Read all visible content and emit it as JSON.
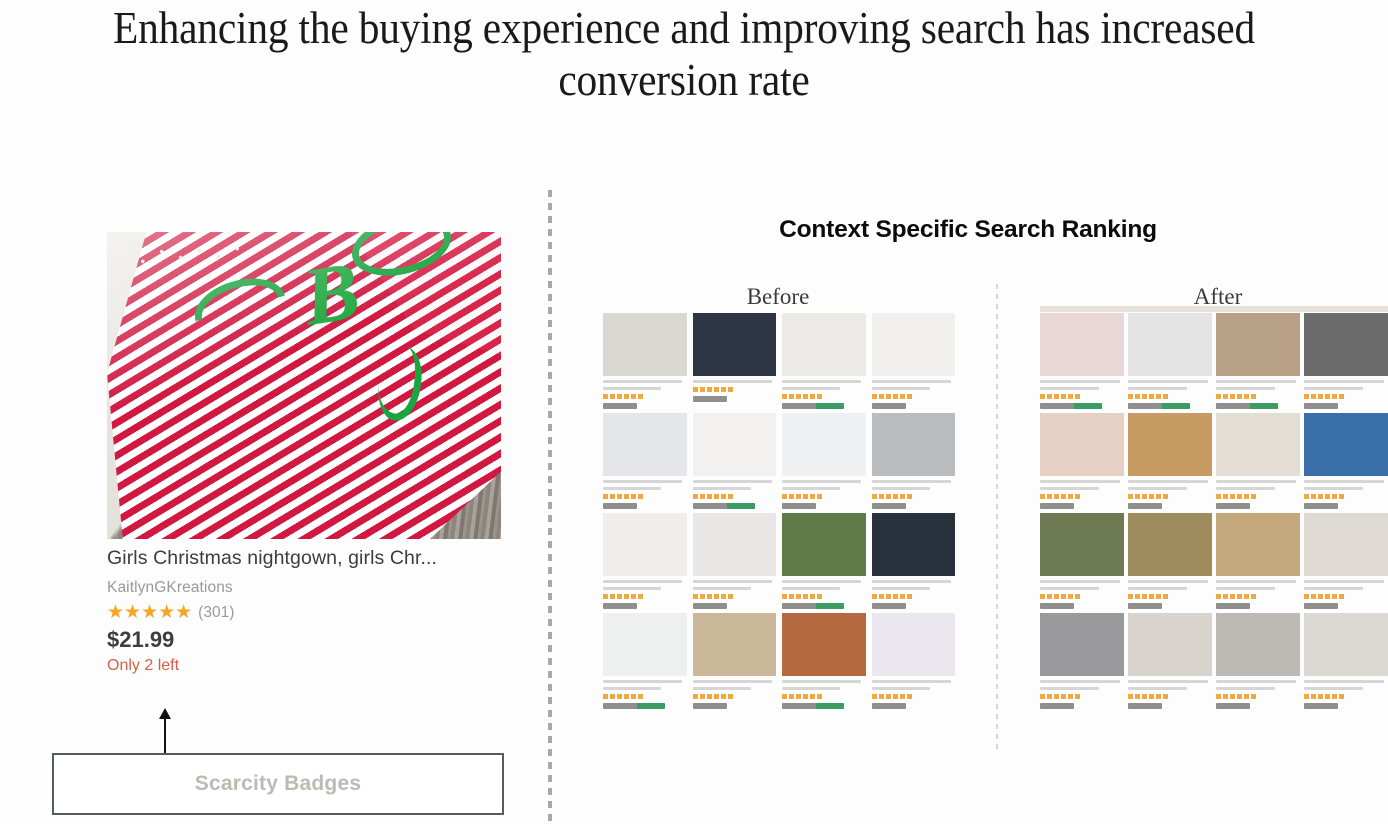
{
  "headline": "Enhancing the buying experience and improving search has increased conversion rate",
  "left_panel": {
    "product_card": {
      "photo_alt": "girls-christmas-nightgown-photo",
      "title": "Girls Christmas nightgown, girls Chr...",
      "shop": "KaitlynGKreations",
      "stars": "★★★★★",
      "star_rating": 5,
      "review_count": "(301)",
      "price": "$21.99",
      "scarcity": "Only 2 left"
    },
    "callout": {
      "label": "Scarcity Badges",
      "arrow": "up-arrow"
    }
  },
  "right_panel": {
    "section_title": "Context Specific Search Ranking",
    "before_label": "Before",
    "after_label": "After",
    "before_grid": {
      "columns": 4,
      "rows": 4,
      "cells": [
        {
          "img_color": "#d9d7d2",
          "lines": 2,
          "price_variant": "short"
        },
        {
          "img_color": "#2d3544",
          "lines": 1,
          "price_variant": "short"
        },
        {
          "img_color": "#eceae7",
          "lines": 2,
          "price_variant": "long"
        },
        {
          "img_color": "#f2f0ee",
          "lines": 2,
          "price_variant": "short"
        },
        {
          "img_color": "#e4e6ea",
          "lines": 2,
          "price_variant": "short"
        },
        {
          "img_color": "#f3f1ef",
          "lines": 2,
          "price_variant": "long"
        },
        {
          "img_color": "#eef0f2",
          "lines": 2,
          "price_variant": "short"
        },
        {
          "img_color": "#b9bcbe",
          "lines": 2,
          "price_variant": "short"
        },
        {
          "img_color": "#efeeea",
          "lines": 2,
          "price_variant": "short"
        },
        {
          "img_color": "#e8e7e5",
          "lines": 2,
          "price_variant": "short"
        },
        {
          "img_color": "#5d7a48",
          "lines": 2,
          "price_variant": "long"
        },
        {
          "img_color": "#28323c",
          "lines": 2,
          "price_variant": "short"
        },
        {
          "img_color": "#eeefef",
          "lines": 2,
          "price_variant": "long"
        },
        {
          "img_color": "#cbb89a",
          "lines": 2,
          "price_variant": "short"
        },
        {
          "img_color": "#b5693f",
          "lines": 2,
          "price_variant": "long"
        },
        {
          "img_color": "#eae8ee",
          "lines": 2,
          "price_variant": "short"
        }
      ]
    },
    "after_grid": {
      "columns": 4,
      "rows": 4,
      "cells": [
        {
          "img_color": "#e9d7d8",
          "lines": 2,
          "price_variant": "long"
        },
        {
          "img_color": "#e4e4e4",
          "lines": 2,
          "price_variant": "long"
        },
        {
          "img_color": "#b8a187",
          "lines": 2,
          "price_variant": "long"
        },
        {
          "img_color": "#6b6b6c",
          "lines": 2,
          "price_variant": "short"
        },
        {
          "img_color": "#e6cfc4",
          "lines": 2,
          "price_variant": "short"
        },
        {
          "img_color": "#c79b63",
          "lines": 2,
          "price_variant": "short"
        },
        {
          "img_color": "#e3ddd6",
          "lines": 2,
          "price_variant": "short"
        },
        {
          "img_color": "#3b6fa8",
          "lines": 2,
          "price_variant": "short"
        },
        {
          "img_color": "#6d7a53",
          "lines": 2,
          "price_variant": "short"
        },
        {
          "img_color": "#9e8c5f",
          "lines": 2,
          "price_variant": "short"
        },
        {
          "img_color": "#c3a87b",
          "lines": 2,
          "price_variant": "short"
        },
        {
          "img_color": "#dedad3",
          "lines": 2,
          "price_variant": "short"
        },
        {
          "img_color": "#9a9a9c",
          "lines": 2,
          "price_variant": "short"
        },
        {
          "img_color": "#d8d4cd",
          "lines": 2,
          "price_variant": "short"
        },
        {
          "img_color": "#bdb9b4",
          "lines": 2,
          "price_variant": "short"
        },
        {
          "img_color": "#dcd8d2",
          "lines": 2,
          "price_variant": "short"
        }
      ]
    }
  },
  "colors": {
    "background": "#fdfdfd",
    "star_orange": "#f6a623",
    "scarcity_red": "#d35f4a",
    "price_dark": "#3d3d3d",
    "muted_grey": "#9a9a9a",
    "callout_border": "#555b63",
    "callout_text": "#bdb9b3",
    "divider_dot": "#a9a9a9"
  }
}
